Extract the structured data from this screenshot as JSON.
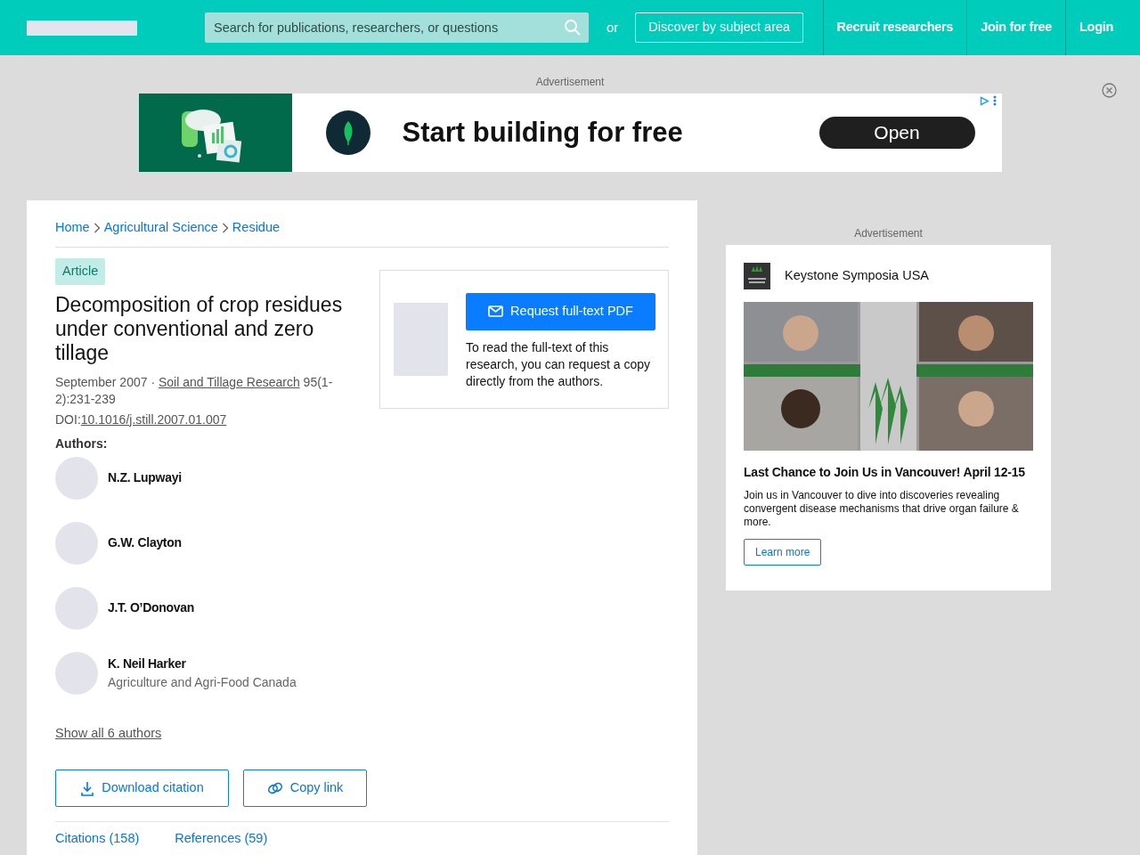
{
  "header": {
    "search": {
      "placeholder": "Search for publications, researchers, or questions"
    },
    "or_text": "or",
    "discover_button": "Discover by subject area",
    "nav": [
      "Recruit researchers",
      "Join for free",
      "Login"
    ]
  },
  "top_ad": {
    "label": "Advertisement",
    "headline": "Start building for free",
    "button": "Open"
  },
  "breadcrumb": [
    "Home",
    "Agricultural Science",
    "Residue"
  ],
  "article": {
    "type_badge": "Article",
    "title": "Decomposition of crop residues under conventional and zero tillage",
    "date": "September 2007 · ",
    "journal": "Soil and Tillage Research",
    "pages": " 95(1-2):231-239",
    "doi_label": "DOI:",
    "doi": "10.1016/j.still.2007.01.007"
  },
  "request": {
    "button": "Request full-text PDF",
    "text": "To read the full-text of this research, you can request a copy directly from the authors."
  },
  "authors_label": "Authors:",
  "authors": [
    {
      "name": "N.Z. Lupwayi"
    },
    {
      "name": "G.W. Clayton"
    },
    {
      "name": "J.T. O’Donovan"
    },
    {
      "name": "K. Neil Harker",
      "affiliation": "Agriculture and Agri-Food Canada"
    }
  ],
  "show_all": "Show all 6 authors",
  "actions": [
    "Download citation",
    "Copy link"
  ],
  "tabs": [
    "Citations (158)",
    "References (59)"
  ],
  "side_ad": {
    "label": "Advertisement",
    "advertiser": "Keystone Symposia USA",
    "headline": "Last Chance to Join Us in Vancouver! April 12-15",
    "body": "Join us in Vancouver to dive into discoveries revealing convergent disease mechanisms that drive organ failure & more.",
    "button": "Learn more"
  }
}
